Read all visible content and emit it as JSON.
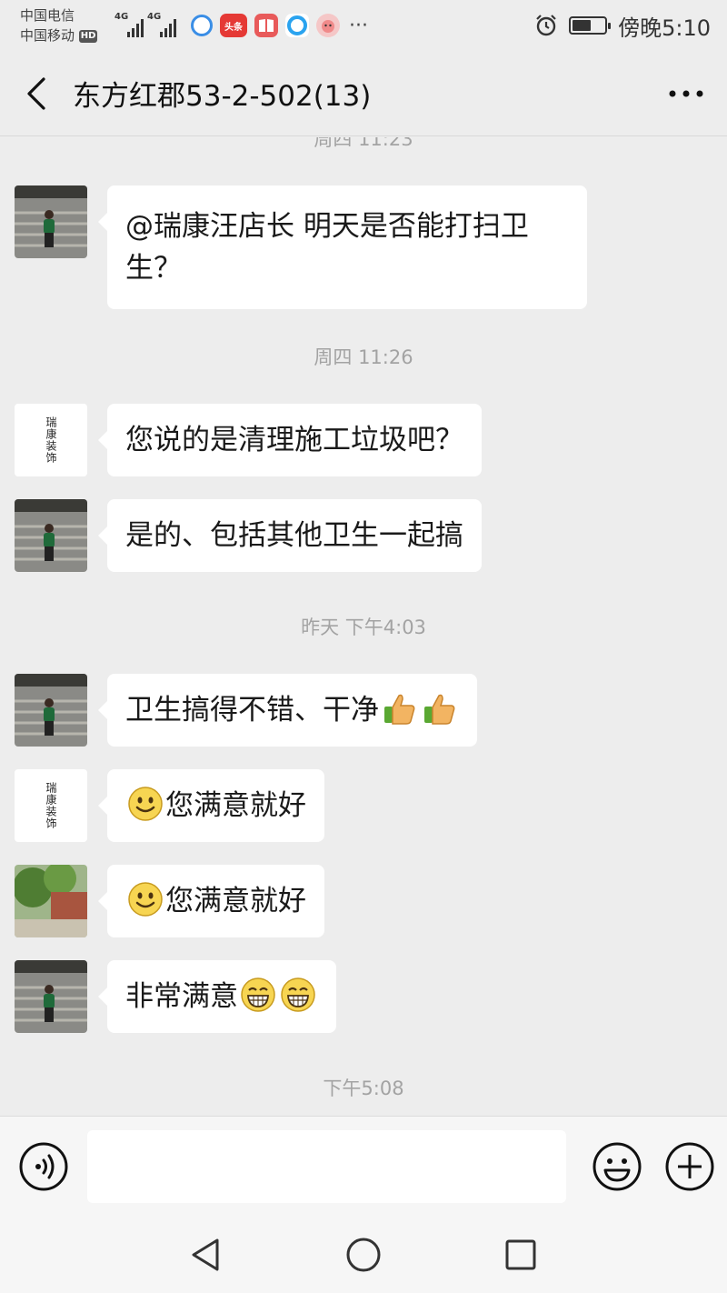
{
  "status_bar": {
    "carrier1": "中国电信",
    "carrier2": "中国移动",
    "hd_badge": "HD",
    "network1": "4G",
    "network2": "4G",
    "app_toutiao": "头条",
    "time": "傍晚5:10"
  },
  "header": {
    "title": "东方红郡53-2-502(13)"
  },
  "chat": {
    "timestamps": {
      "t0": "周四 11:23",
      "t1": "周四 11:26",
      "t2": "昨天 下午4:03",
      "t3": "下午5:08"
    },
    "messages": [
      {
        "sender": "customer",
        "text": "@瑞康汪店长  明天是否能打扫卫生？"
      },
      {
        "sender": "store",
        "text": "您说的是清理施工垃圾吧？",
        "avatar_text": "瑞康装饰"
      },
      {
        "sender": "customer",
        "text": "是的、包括其他卫生一起搞"
      },
      {
        "sender": "customer",
        "text": "卫生搞得不错、干净",
        "emoji": "thumbs-up x2"
      },
      {
        "sender": "store",
        "text": "您满意就好",
        "emoji": "smile",
        "avatar_text": "瑞康装饰"
      },
      {
        "sender": "member",
        "text": "您满意就好",
        "emoji": "smile"
      },
      {
        "sender": "customer",
        "text": "非常满意",
        "emoji": "grin x2"
      }
    ]
  },
  "input": {
    "value": "",
    "placeholder": ""
  },
  "colors": {
    "background": "#ededed",
    "bubble": "#ffffff",
    "timestamp": "#a3a3a3"
  }
}
